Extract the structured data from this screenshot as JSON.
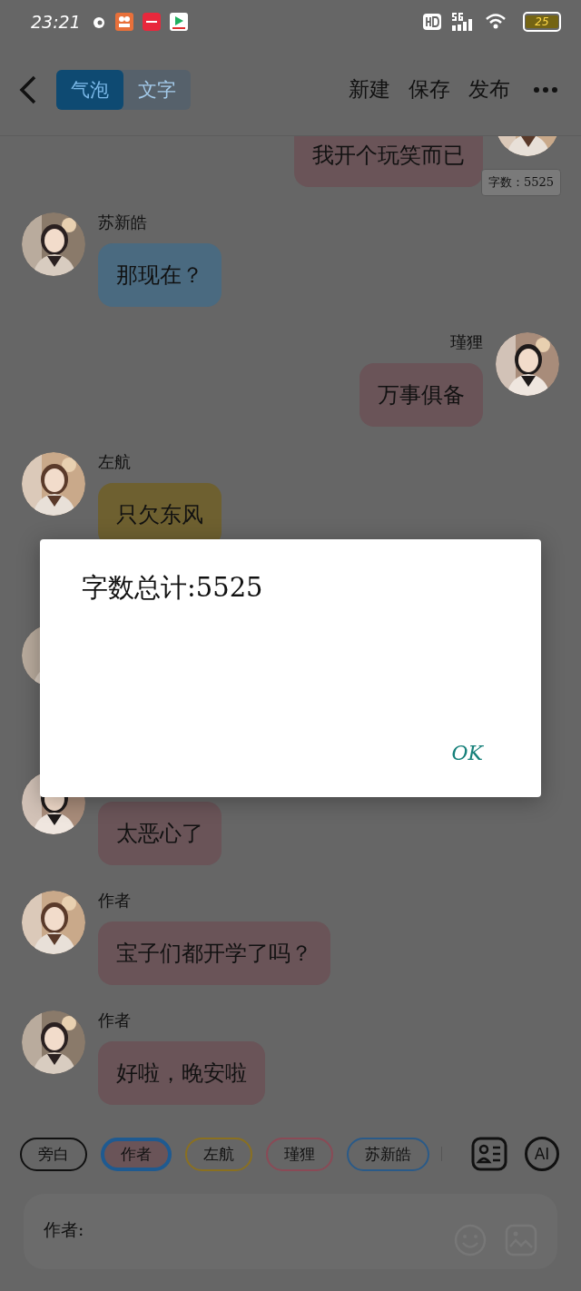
{
  "status_bar": {
    "time": "23:21",
    "battery": "25"
  },
  "toolbar": {
    "tabs": [
      {
        "label": "气泡",
        "selected": true
      },
      {
        "label": "文字",
        "selected": false
      }
    ],
    "actions": [
      "新建",
      "保存",
      "发布"
    ]
  },
  "word_count_badge": "字数：5525",
  "messages": [
    {
      "kind": "message",
      "outgoing": true,
      "color": "#6a5458",
      "text": "我开个玩笑而已"
    },
    {
      "kind": "message",
      "outgoing": false,
      "name": "苏新皓",
      "color": "#4a6a80",
      "text": "那现在？"
    },
    {
      "kind": "message",
      "outgoing": true,
      "name": "瑾狸",
      "color": "#6a5458",
      "text": "万事俱备"
    },
    {
      "kind": "message",
      "outgoing": false,
      "name": "左航",
      "color": "#6e6030",
      "text": "只欠东风"
    },
    {
      "kind": "obscured",
      "outgoing": false
    },
    {
      "kind": "message",
      "outgoing": false,
      "color": "#6a5458",
      "text": "太恶心了"
    },
    {
      "kind": "message",
      "outgoing": false,
      "name": "作者",
      "color": "#6a5458",
      "text": "宝子们都开学了吗？"
    },
    {
      "kind": "message",
      "outgoing": false,
      "name": "作者",
      "color": "#6a5458",
      "text": "好啦，晚安啦"
    }
  ],
  "roles": [
    {
      "label": "旁白",
      "color": "#111111",
      "selected": false
    },
    {
      "label": "作者",
      "color": "#6a5458",
      "selected": true
    },
    {
      "label": "左航",
      "color": "#8a7020",
      "selected": false
    },
    {
      "label": "瑾狸",
      "color": "#8a4a56",
      "selected": false
    },
    {
      "label": "苏新皓",
      "color": "#2a5a88",
      "selected": false
    }
  ],
  "ai_button": "AI",
  "composer": {
    "label": "作者:"
  },
  "dialog": {
    "message": "字数总计:5525",
    "button": "OK"
  }
}
